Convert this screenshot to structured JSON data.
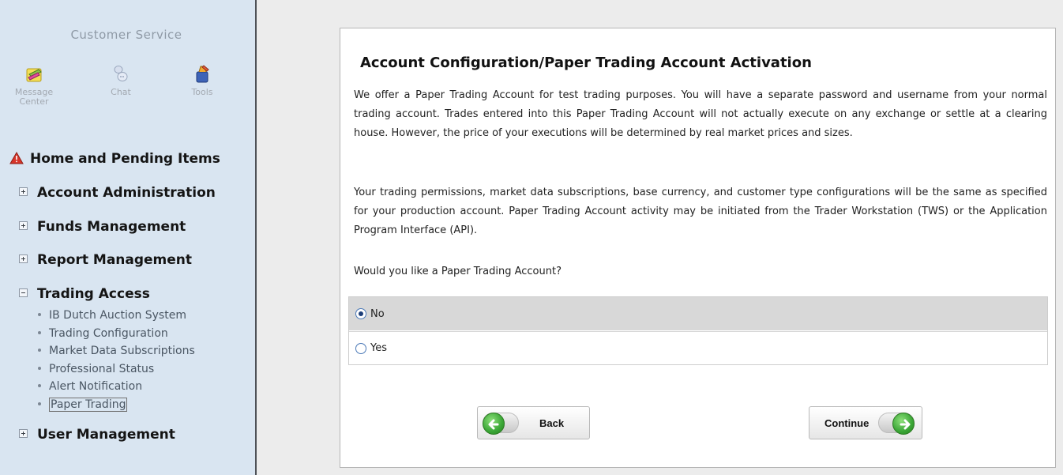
{
  "sidebar": {
    "customer_service_title": "Customer Service",
    "icons": [
      {
        "label": "Message\nCenter",
        "label_line1": "Message",
        "label_line2": "Center",
        "icon": "message-center-icon"
      },
      {
        "label": "Chat",
        "icon": "chat-icon"
      },
      {
        "label": "Tools",
        "icon": "tools-icon"
      }
    ],
    "nav": {
      "home": "Home and Pending Items",
      "account_admin": "Account Administration",
      "funds": "Funds Management",
      "report": "Report Management",
      "trading_access": "Trading Access",
      "user_mgmt": "User Management"
    },
    "trading_access_items": [
      "IB Dutch Auction System",
      "Trading Configuration",
      "Market Data Subscriptions",
      "Professional Status",
      "Alert Notification",
      "Paper Trading"
    ],
    "active_item": "Paper Trading"
  },
  "main": {
    "title": "Account Configuration/Paper Trading Account Activation",
    "paragraph1": "We offer a Paper Trading Account for test trading purposes. You will have a separate password and username from your normal trading account. Trades entered into this Paper Trading Account will not actually execute on any exchange or settle at a clearing house. However, the price of your executions will be determined by real market prices and sizes.",
    "paragraph2": "Your trading permissions, market data subscriptions, base currency, and customer type configurations will be the same as specified for your production account. Paper Trading Account activity may be initiated from the Trader Workstation (TWS) or the Application Program Interface (API).",
    "question": "Would you like a Paper Trading Account?",
    "options": [
      {
        "label": "No",
        "selected": true
      },
      {
        "label": "Yes",
        "selected": false
      }
    ],
    "back_label": "Back",
    "continue_label": "Continue"
  },
  "colors": {
    "sidebar_bg": "#d9e5f1",
    "selected_row": "#d8d8d8",
    "arrow_green": "#3aa636",
    "warning_red": "#d8352a"
  }
}
